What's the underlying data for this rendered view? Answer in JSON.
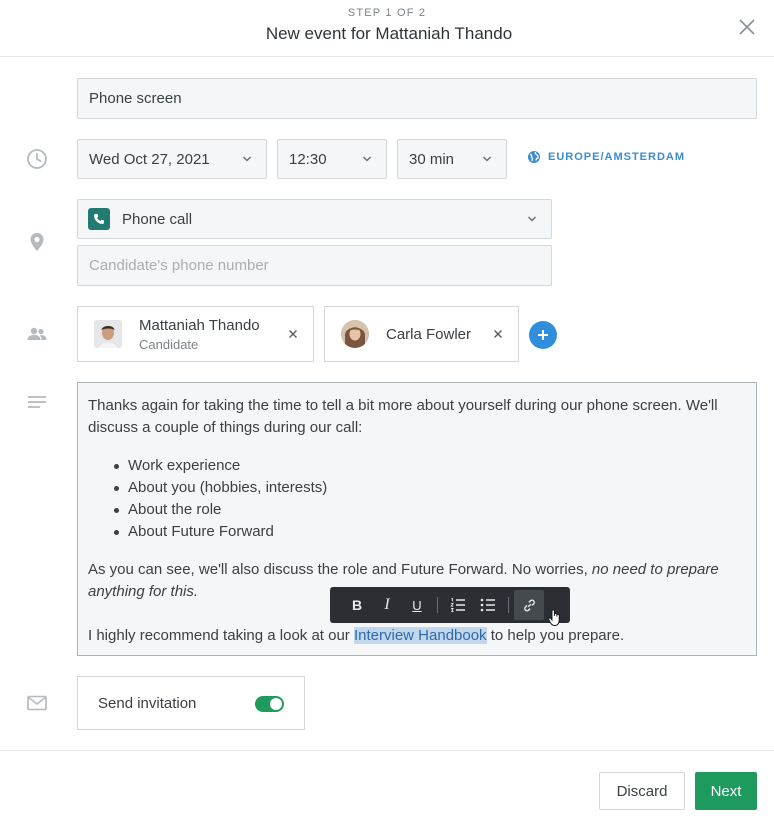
{
  "header": {
    "step": "STEP 1 OF 2",
    "title": "New event for Mattaniah Thando"
  },
  "event": {
    "title_value": "Phone screen",
    "date": "Wed Oct 27, 2021",
    "time": "12:30",
    "duration": "30 min",
    "timezone": "EUROPE/AMSTERDAM",
    "location_type": "Phone call",
    "phone_placeholder": "Candidate's phone number"
  },
  "attendees": [
    {
      "name": "Mattaniah Thando",
      "role": "Candidate"
    },
    {
      "name": "Carla Fowler",
      "role": ""
    }
  ],
  "description": {
    "intro": "Thanks again for taking the time to tell a bit more about yourself during our phone screen. We'll discuss a couple of things during our call:",
    "bullets": [
      "Work experience",
      "About you (hobbies, interests)",
      "About the role",
      "About Future Forward"
    ],
    "para2_plain": "As you can see, we'll also discuss the role and Future Forward. No worries, ",
    "para2_italic": "no need to prepare anything for this.",
    "para3_before": "I highly recommend taking a look at our ",
    "para3_link": "Interview Handbook",
    "para3_after": " to help you prepare."
  },
  "toolbar": {
    "bold": "B",
    "italic": "I",
    "underline": "U"
  },
  "invitation": {
    "label": "Send invitation",
    "enabled": true
  },
  "footer": {
    "discard": "Discard",
    "next": "Next"
  },
  "colors": {
    "accent_green": "#1f9a5e",
    "link_blue": "#3a8dd0",
    "add_blue": "#2f8fdc",
    "phone_teal": "#237a73"
  },
  "icons": [
    "close-icon",
    "clock-icon",
    "location-pin-icon",
    "people-icon",
    "text-lines-icon",
    "mail-icon",
    "globe-icon",
    "phone-icon",
    "plus-icon",
    "link-icon",
    "ordered-list-icon",
    "bullet-list-icon"
  ]
}
